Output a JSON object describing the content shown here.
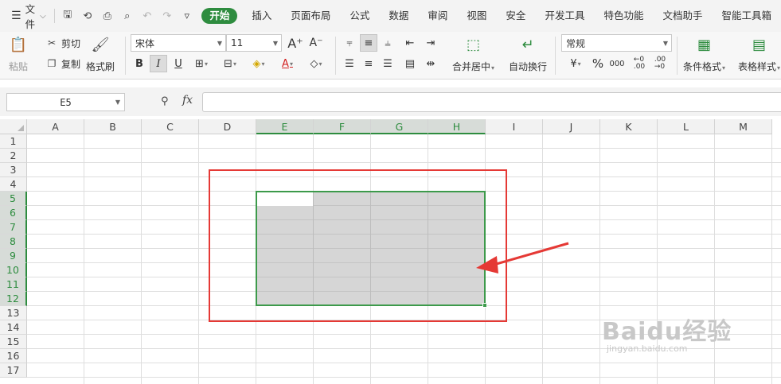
{
  "menubar": {
    "file_label": "文件",
    "tabs": [
      "开始",
      "插入",
      "页面布局",
      "公式",
      "数据",
      "审阅",
      "视图",
      "安全",
      "开发工具",
      "特色功能",
      "文档助手",
      "智能工具箱"
    ],
    "active_tab": "开始"
  },
  "ribbon": {
    "paste_label": "粘贴",
    "cut_label": "剪切",
    "copy_label": "复制",
    "format_painter_label": "格式刷",
    "font_name": "宋体",
    "font_size": "11",
    "merge_center_label": "合并居中",
    "wrap_text_label": "自动换行",
    "number_format": "常规",
    "percent_symbol": "%",
    "conditional_format_label": "条件格式",
    "table_style_label": "表格样式"
  },
  "formula_bar": {
    "name_box": "E5",
    "fx_label": "fx",
    "formula_value": ""
  },
  "sheet": {
    "columns": [
      "A",
      "B",
      "C",
      "D",
      "E",
      "F",
      "G",
      "H",
      "I",
      "J",
      "K",
      "L",
      "M"
    ],
    "rows": [
      "1",
      "2",
      "3",
      "4",
      "5",
      "6",
      "7",
      "8",
      "9",
      "10",
      "11",
      "12",
      "13",
      "14",
      "15",
      "16",
      "17"
    ],
    "selected_columns": [
      "E",
      "F",
      "G",
      "H"
    ],
    "selected_rows": [
      "5",
      "6",
      "7",
      "8",
      "9",
      "10",
      "11",
      "12"
    ],
    "active_cell": "E5",
    "selection_range": "E5:H12"
  },
  "annotation": {
    "highlight_color": "#e53935",
    "selection_color": "#3d9a4b"
  },
  "watermark": {
    "brand": "Baidu经验",
    "url": "jingyan.baidu.com"
  },
  "colors": {
    "accent_green": "#2e8c3f",
    "selection_fill": "#d6d6d6"
  }
}
